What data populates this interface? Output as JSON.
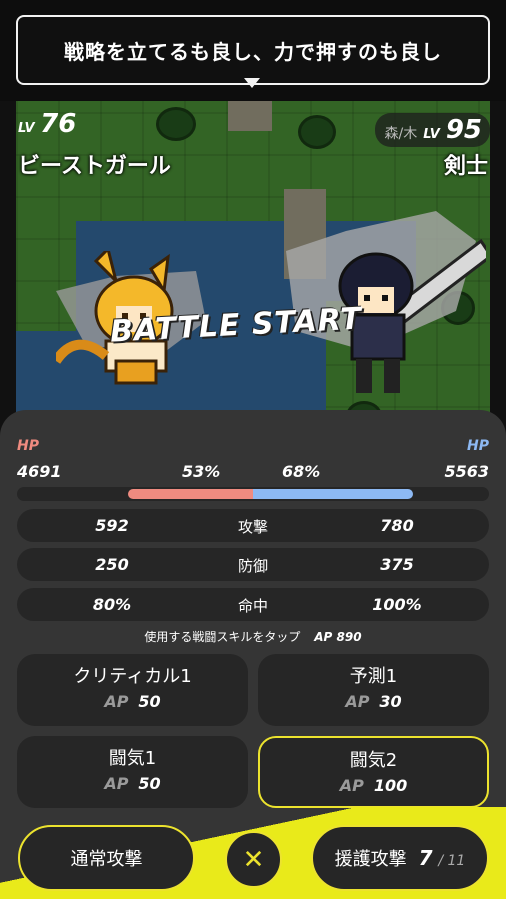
{
  "banner": {
    "text": "戦略を立てるも良し、力で押すのも良し"
  },
  "left_unit": {
    "lv_label": "LV",
    "level": "76",
    "name": "ビーストガール",
    "hp_label": "HP",
    "hp": "4691",
    "hp_percent": "53%",
    "hp_fraction": 0.53
  },
  "right_unit": {
    "terrain": "森/木",
    "lv_label": "LV",
    "level": "95",
    "name": "剣士",
    "hp_label": "HP",
    "hp": "5563",
    "hp_percent": "68%",
    "hp_fraction": 0.68
  },
  "battle_text": "BATTLE START",
  "stats": [
    {
      "left": "592",
      "label": "攻撃",
      "right": "780"
    },
    {
      "left": "250",
      "label": "防御",
      "right": "375"
    },
    {
      "left": "80%",
      "label": "命中",
      "right": "100%"
    }
  ],
  "hint": {
    "text": "使用する戦闘スキルをタップ",
    "ap": "AP 890"
  },
  "skills": [
    {
      "name": "クリティカル1",
      "ap_label": "AP",
      "cost": "50"
    },
    {
      "name": "予測1",
      "ap_label": "AP",
      "cost": "30"
    },
    {
      "name": "闘気1",
      "ap_label": "AP",
      "cost": "50"
    },
    {
      "name": "闘気2",
      "ap_label": "AP",
      "cost": "100"
    }
  ],
  "buttons": {
    "normal": "通常攻撃",
    "close": "✕",
    "support": "援護攻撃",
    "support_count": "7",
    "support_total": "/ 11"
  },
  "colors": {
    "accent": "#ece32e",
    "left_hp": "#ef8b80",
    "right_hp": "#8db9f3"
  }
}
